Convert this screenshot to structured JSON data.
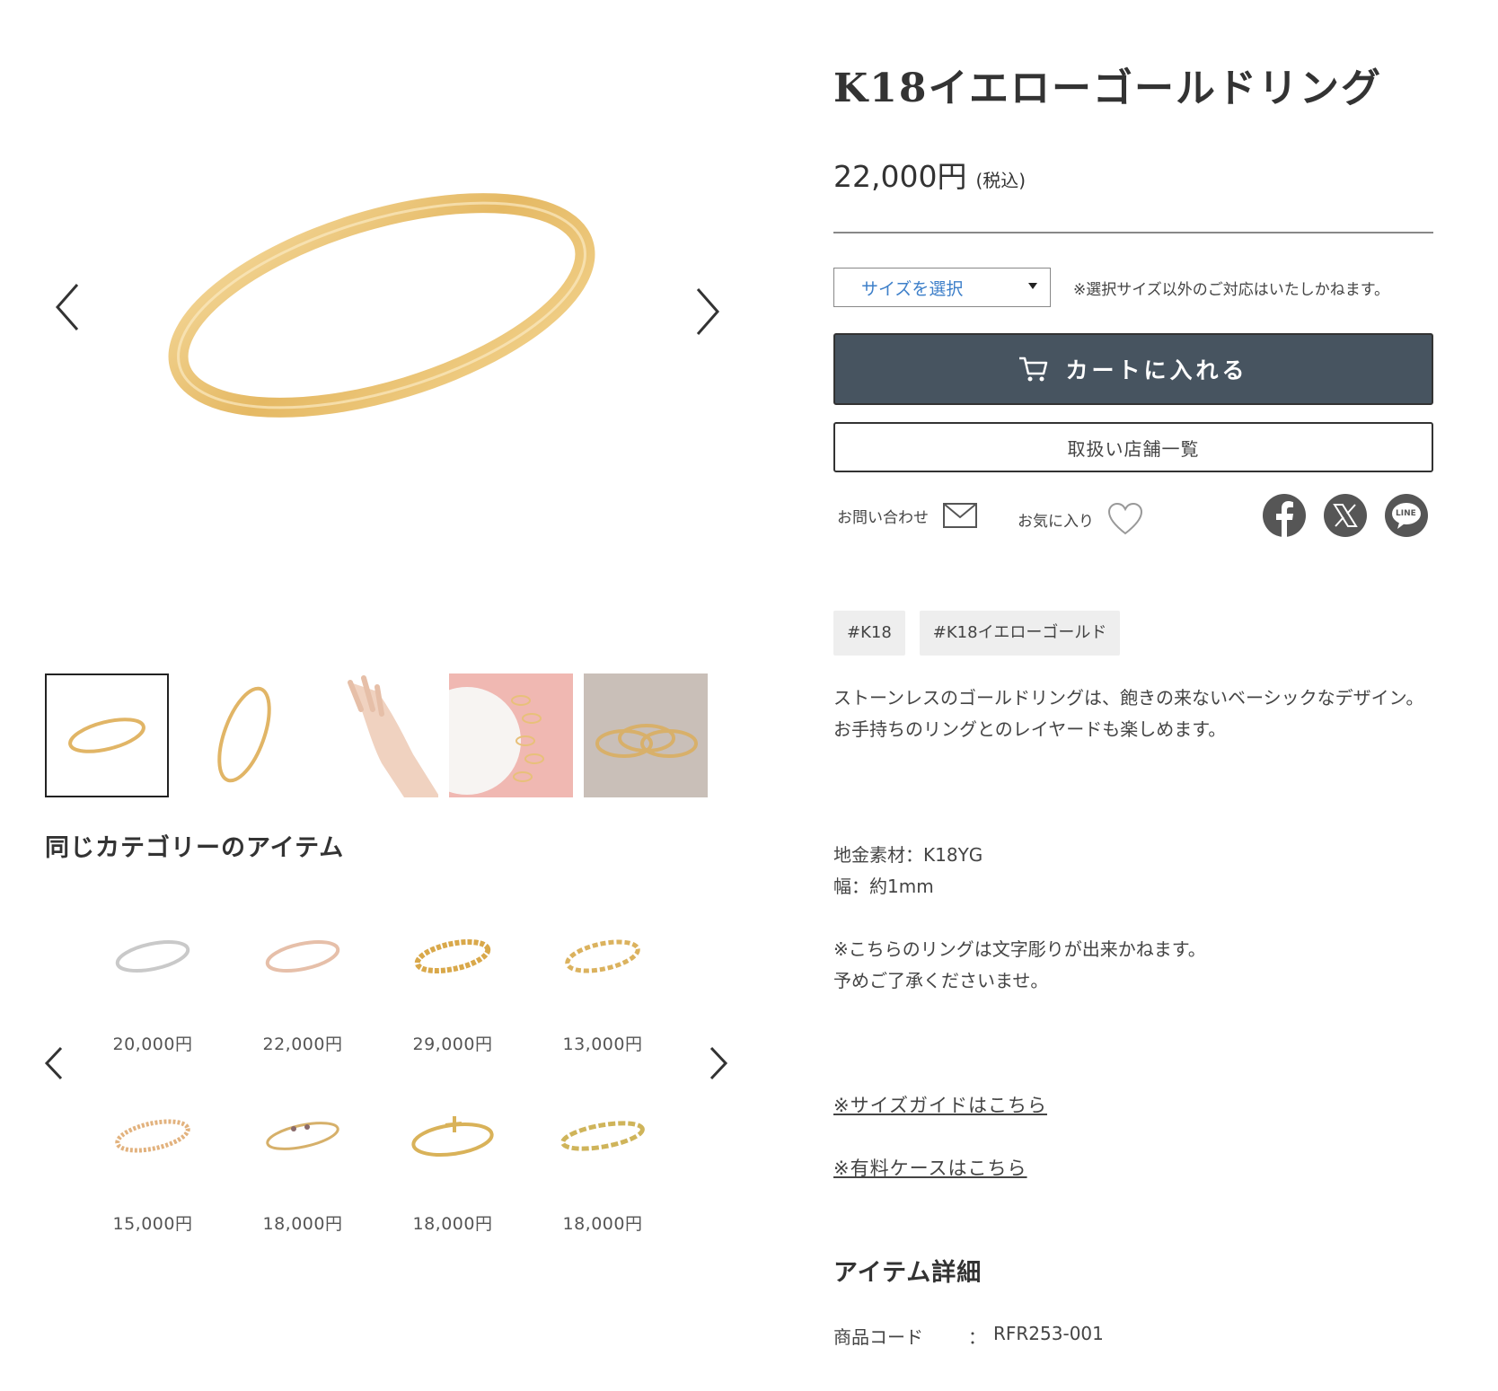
{
  "product": {
    "title": "K18イエローゴールドリング",
    "price": "22,000円",
    "tax_note": "(税込)",
    "size_select_label": "サイズを選択",
    "size_note": "※選択サイズ以外のご対応はいたしかねます。",
    "cart_button": "カートに入れる",
    "store_button": "取扱い店舗一覧",
    "contact_label": "お問い合わせ",
    "favorite_label": "お気に入り",
    "tags": [
      "#K18",
      "#K18イエローゴールド"
    ],
    "description": [
      "ストーンレスのゴールドリングは、飽きの来ないベーシックなデザイン。",
      "お手持ちのリングとのレイヤードも楽しめます。"
    ],
    "specs": [
      "地金素材：K18YG",
      "幅：約1mm"
    ],
    "notes": [
      "※こちらのリングは文字彫りが出来かねます。",
      "予めご了承くださいませ。"
    ],
    "size_guide_link": "※サイズガイドはこちら",
    "case_link": "※有料ケースはこちら",
    "detail_title": "アイテム詳細",
    "code_label": "商品コード",
    "code_sep": "：",
    "code_value": "RFR253-001"
  },
  "social": {
    "line_text": "LINE"
  },
  "related": {
    "title": "同じカテゴリーのアイテム",
    "items": [
      {
        "price": "20,000円",
        "color": "#c9c9c9"
      },
      {
        "price": "22,000円",
        "color": "#e6bfa9"
      },
      {
        "price": "29,000円",
        "color": "#d9a84a"
      },
      {
        "price": "13,000円",
        "color": "#dbb25e"
      },
      {
        "price": "15,000円",
        "color": "#e2b27e"
      },
      {
        "price": "18,000円",
        "color": "#d6b06a"
      },
      {
        "price": "18,000円",
        "color": "#d9b259"
      },
      {
        "price": "18,000円",
        "color": "#cfb45a"
      }
    ]
  },
  "colors": {
    "accent_select": "#3d7fc9",
    "cart_button_bg": "#475460",
    "gold": "#e8c07a",
    "social_bg": "#565656"
  }
}
